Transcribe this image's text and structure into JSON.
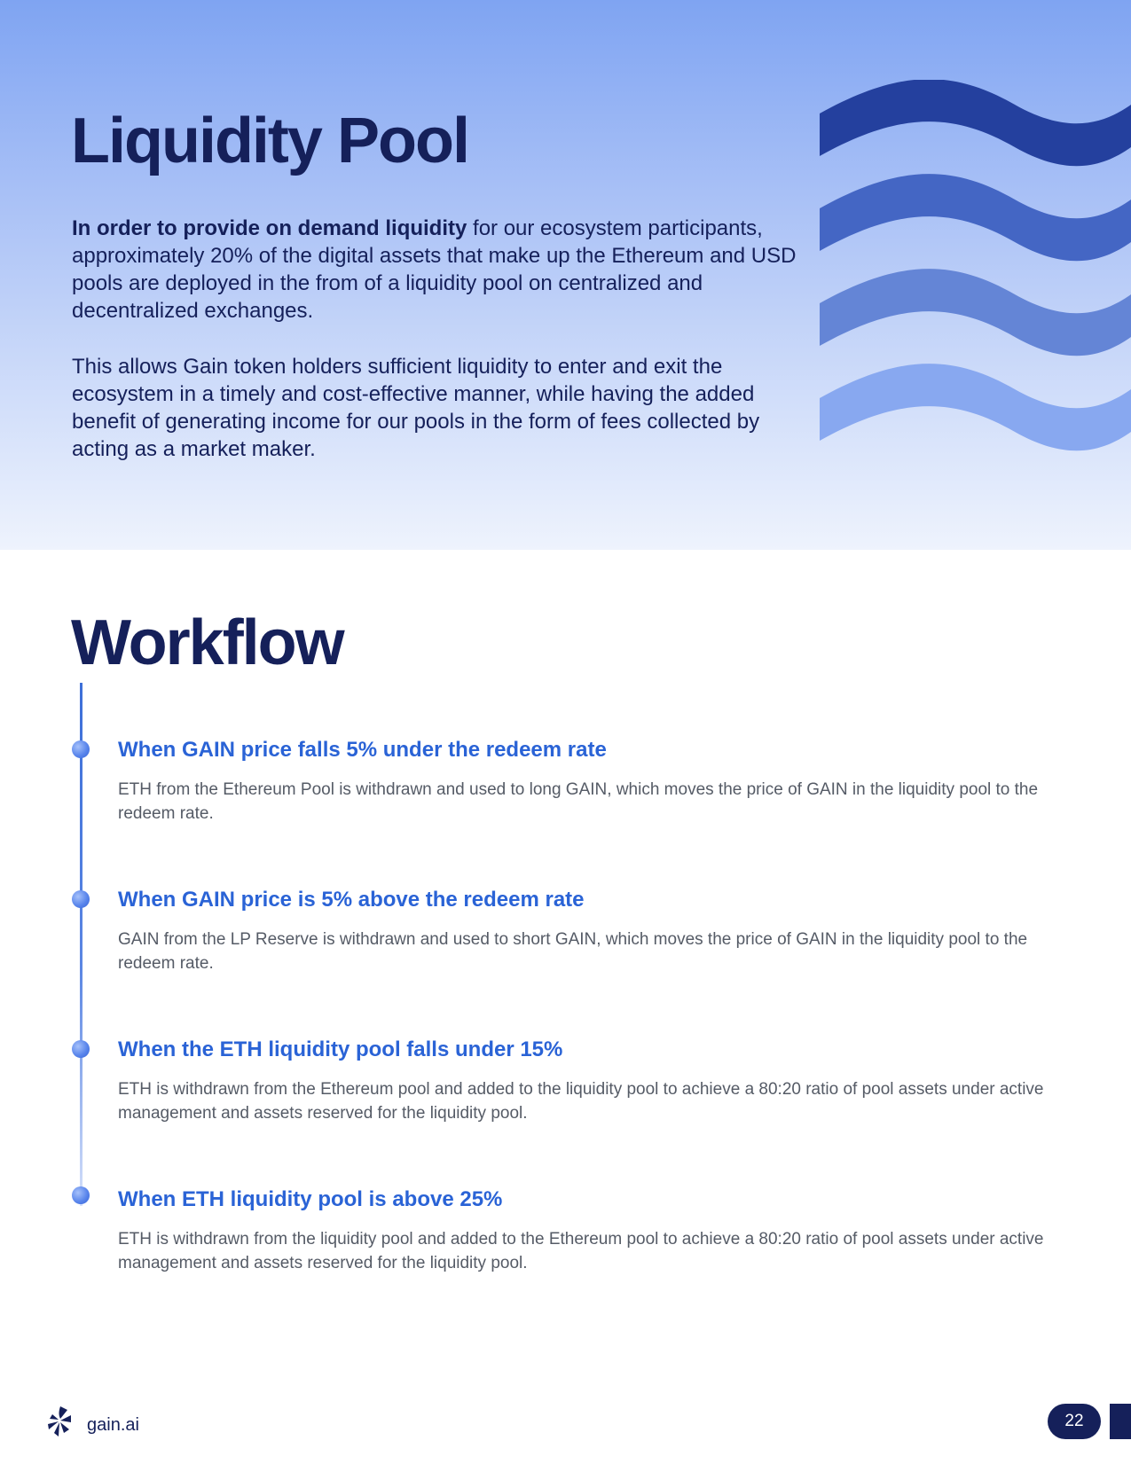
{
  "hero": {
    "title": "Liquidity Pool",
    "paragraph1_bold": "In order to provide on demand liquidity",
    "paragraph1_rest": " for our ecosystem participants, approximately 20% of the digital assets that make up the Ethereum and USD pools are deployed in the from of a liquidity pool on centralized and decentralized exchanges.",
    "paragraph2": "This allows Gain token holders sufficient liquidity to enter and exit the ecosystem in a timely and cost-effective manner, while having the added benefit of generating income for our pools in the form of fees collected by acting as a market maker."
  },
  "workflow": {
    "title": "Workflow",
    "steps": [
      {
        "title": "When GAIN price falls 5% under the redeem rate",
        "text": "ETH from the Ethereum Pool is withdrawn and used to long GAIN, which moves the price of GAIN in the liquidity pool to the redeem rate."
      },
      {
        "title": "When GAIN price is 5% above the redeem rate",
        "text": "GAIN from the LP Reserve is withdrawn and used to short GAIN, which moves the price of GAIN in the liquidity pool to the redeem rate."
      },
      {
        "title": "When the ETH liquidity pool falls under 15%",
        "text": "ETH is withdrawn from the Ethereum pool and added to the liquidity pool to achieve a 80:20 ratio of pool assets under active management and assets reserved for the liquidity pool."
      },
      {
        "title": "When ETH liquidity pool is above 25%",
        "text": "ETH is withdrawn from the liquidity pool and added to the Ethereum pool to achieve a 80:20 ratio of pool assets under active management and assets reserved for the liquidity pool."
      }
    ]
  },
  "footer": {
    "brand": "gain.ai",
    "page_number": "22",
    "logo_icon": "gain-logo-icon"
  },
  "colors": {
    "navy": "#15205a",
    "accent_blue": "#2a63d6",
    "wave_1": "#24409e",
    "wave_2": "#4466c4",
    "wave_3": "#6485d6",
    "wave_4": "#88a8f0"
  }
}
